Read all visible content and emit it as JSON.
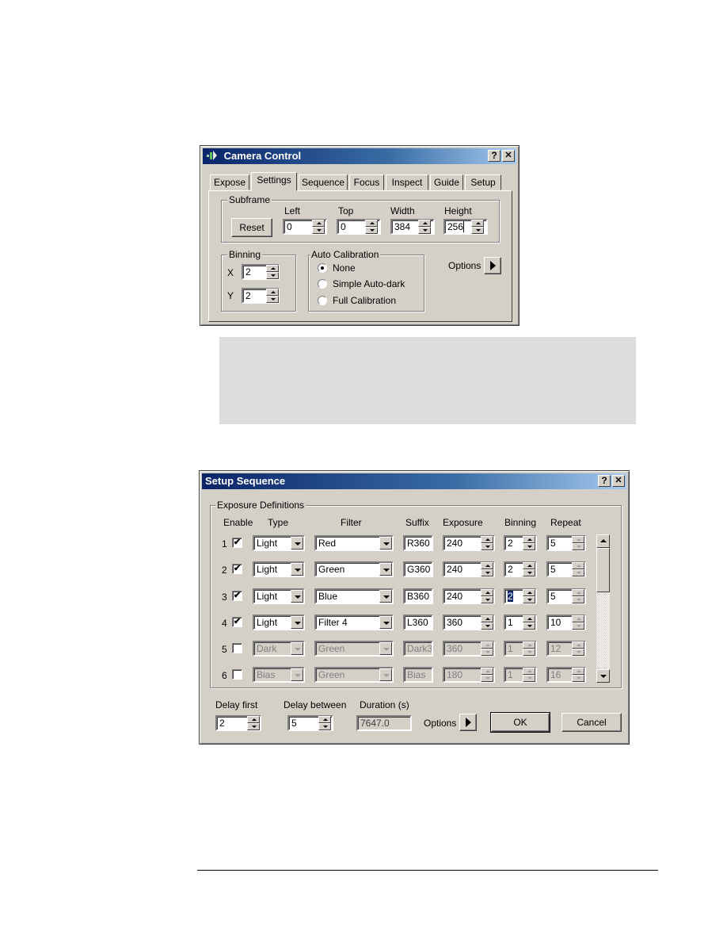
{
  "camera_control": {
    "title": "Camera Control",
    "help_button": "?",
    "close_button": "✕",
    "tabs": [
      {
        "label": "Expose",
        "active": false
      },
      {
        "label": "Settings",
        "active": true
      },
      {
        "label": "Sequence",
        "active": false
      },
      {
        "label": "Focus",
        "active": false
      },
      {
        "label": "Inspect",
        "active": false
      },
      {
        "label": "Guide",
        "active": false
      },
      {
        "label": "Setup",
        "active": false
      }
    ],
    "subframe": {
      "label": "Subframe",
      "reset_label": "Reset",
      "left_label": "Left",
      "left_value": "0",
      "top_label": "Top",
      "top_value": "0",
      "width_label": "Width",
      "width_value": "384",
      "height_label": "Height",
      "height_value": "256"
    },
    "binning": {
      "label": "Binning",
      "x_label": "X",
      "x_value": "2",
      "y_label": "Y",
      "y_value": "2"
    },
    "auto_calibration": {
      "label": "Auto Calibration",
      "options": [
        "None",
        "Simple Auto-dark",
        "Full Calibration"
      ],
      "selected": "None"
    },
    "options_label": "Options"
  },
  "setup_sequence": {
    "title": "Setup Sequence",
    "help_button": "?",
    "close_button": "✕",
    "group_label": "Exposure Definitions",
    "headers": {
      "enable": "Enable",
      "type": "Type",
      "filter": "Filter",
      "suffix": "Suffix",
      "exposure": "Exposure",
      "binning": "Binning",
      "repeat": "Repeat"
    },
    "rows": [
      {
        "num": "1",
        "enabled": true,
        "checkmark": "✔",
        "type": "Light",
        "filter": "Red",
        "suffix": "R360",
        "exposure": "240",
        "binning": "2",
        "repeat": "5"
      },
      {
        "num": "2",
        "enabled": true,
        "checkmark": "✔",
        "type": "Light",
        "filter": "Green",
        "suffix": "G360",
        "exposure": "240",
        "binning": "2",
        "repeat": "5"
      },
      {
        "num": "3",
        "enabled": true,
        "checkmark": "✔",
        "type": "Light",
        "filter": "Blue",
        "suffix": "B360",
        "exposure": "240",
        "binning": "2",
        "repeat": "5"
      },
      {
        "num": "4",
        "enabled": true,
        "checkmark": "✔",
        "type": "Light",
        "filter": "Filter 4",
        "suffix": "L360",
        "exposure": "360",
        "binning": "1",
        "repeat": "10"
      },
      {
        "num": "5",
        "enabled": false,
        "checkmark": "",
        "type": "Dark",
        "filter": "Green",
        "suffix": "Dark3",
        "exposure": "360",
        "binning": "1",
        "repeat": "12"
      },
      {
        "num": "6",
        "enabled": false,
        "checkmark": "",
        "type": "Bias",
        "filter": "Green",
        "suffix": "Bias",
        "exposure": "180",
        "binning": "1",
        "repeat": "16"
      }
    ],
    "delay_first_label": "Delay first",
    "delay_first_value": "2",
    "delay_between_label": "Delay between",
    "delay_between_value": "5",
    "duration_label": "Duration (s)",
    "duration_value": "7647.0",
    "options_label": "Options",
    "ok_label": "OK",
    "cancel_label": "Cancel"
  }
}
